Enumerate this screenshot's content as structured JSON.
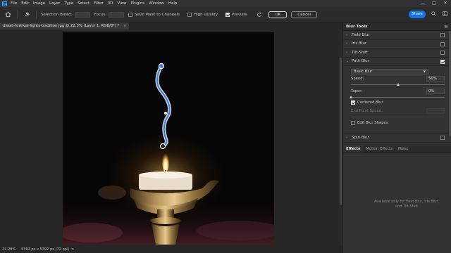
{
  "menubar": {
    "items": [
      "File",
      "Edit",
      "Image",
      "Layer",
      "Type",
      "Select",
      "Filter",
      "3D",
      "View",
      "Plugins",
      "Window",
      "Help"
    ],
    "window_controls": [
      "—",
      "□",
      "✕"
    ]
  },
  "options": {
    "selection_bleed_label": "Selection Bleed:",
    "focus_label": "Focus:",
    "save_mask_label": "Save Mask to Channels",
    "high_quality_label": "High Quality",
    "preview_label": "Preview",
    "preview_checked": true,
    "ok_label": "OK",
    "cancel_label": "Cancel",
    "share_label": "Share"
  },
  "document": {
    "tab_title": "diwali-festival-lights-tradition.jpg @ 22.3% (Layer 1, RGB/8*) *",
    "close": "×"
  },
  "status": {
    "zoom": "22.29%",
    "info": "5392 px x 5392 px (72 ppi)",
    "arrow": ">"
  },
  "blur_tools": {
    "title": "Blur Tools",
    "items": [
      {
        "label": "Field Blur",
        "checked": false
      },
      {
        "label": "Iris Blur",
        "checked": false
      },
      {
        "label": "Tilt-Shift",
        "checked": false
      }
    ],
    "path_blur": {
      "label": "Path Blur",
      "checked": true,
      "mode": "Basic Blur",
      "speed_label": "Speed:",
      "speed_value": "50%",
      "speed_level": 0.5,
      "taper_label": "Taper:",
      "taper_value": "0%",
      "taper_level": 0.0,
      "centered_label": "Centered Blur",
      "centered_checked": true,
      "end_speed_label": "End Point Speed:",
      "edit_shapes_label": "Edit Blur Shapes",
      "edit_shapes_checked": false
    },
    "spin_blur": {
      "label": "Spin Blur",
      "checked": false
    }
  },
  "effects": {
    "tabs": [
      "Effects",
      "Motion Effects",
      "Noise"
    ],
    "active_tab": "Effects",
    "message": "Available only for Field Blur, Iris Blur, and Tilt-Shift"
  },
  "colors": {
    "accent": "#1473e6",
    "panel_bg": "#323232",
    "app_bg": "#262626",
    "path_highlight": "#2f6fe0"
  }
}
